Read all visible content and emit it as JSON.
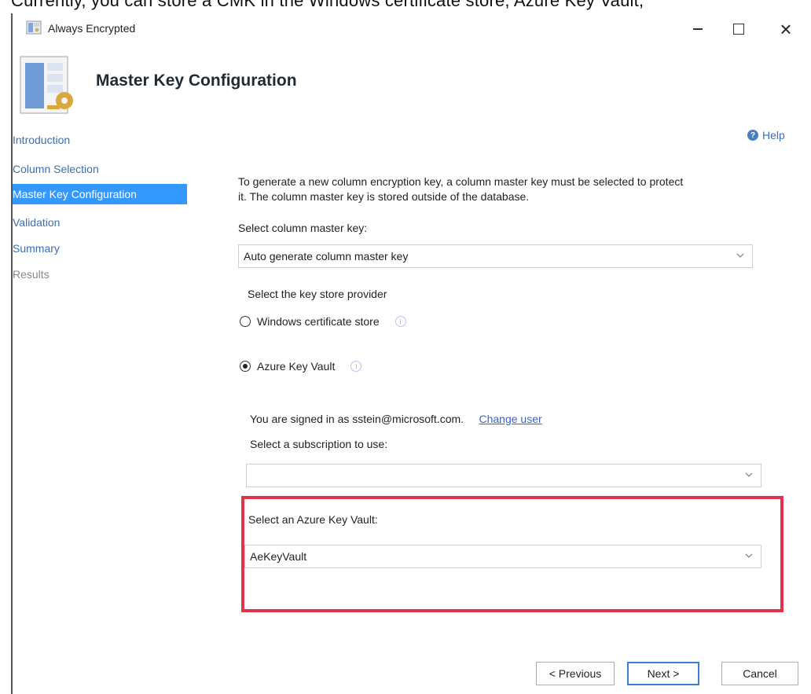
{
  "page_caption_fragment": "Currently, you can store a CMK in the Windows certificate store, Azure Key Vault,",
  "window": {
    "title": "Always Encrypted",
    "controls": {
      "minimize_icon": "minimize-icon",
      "maximize_icon": "maximize-icon",
      "close_icon": "close-icon",
      "close_glyph": "×"
    }
  },
  "header": {
    "title": "Master Key Configuration",
    "icon": "wizard-key-icon"
  },
  "sidebar": {
    "items": [
      {
        "label": "Introduction",
        "state": "link"
      },
      {
        "label": "Column Selection",
        "state": "link"
      },
      {
        "label": "Master Key Configuration",
        "state": "active"
      },
      {
        "label": "Validation",
        "state": "link"
      },
      {
        "label": "Summary",
        "state": "link"
      },
      {
        "label": "Results",
        "state": "disabled"
      }
    ]
  },
  "help": {
    "label": "Help",
    "icon": "help-icon"
  },
  "main": {
    "description_line1": "To generate a new column encryption key, a column master key must be selected to protect",
    "description_line2": "it.  The column master key is stored outside of the database.",
    "cmk_label": "Select column master key:",
    "cmk_value": "Auto generate column master key",
    "provider_label": "Select the key store provider",
    "providers": [
      {
        "label": "Windows certificate store",
        "selected": false
      },
      {
        "label": "Azure Key Vault",
        "selected": true
      }
    ],
    "signed_in_text": "You are signed in as sstein@microsoft.com.",
    "change_user_label": "Change user",
    "subscription_label": "Select a subscription to use:",
    "subscription_value": "",
    "vault_label": "Select an Azure Key Vault:",
    "vault_value": "AeKeyVault"
  },
  "footer": {
    "previous_label": "< Previous",
    "next_label": "Next >",
    "cancel_label": "Cancel"
  },
  "colors": {
    "accent": "#3399ff",
    "link": "#3a6fb0",
    "highlight_border": "#e0344a"
  }
}
